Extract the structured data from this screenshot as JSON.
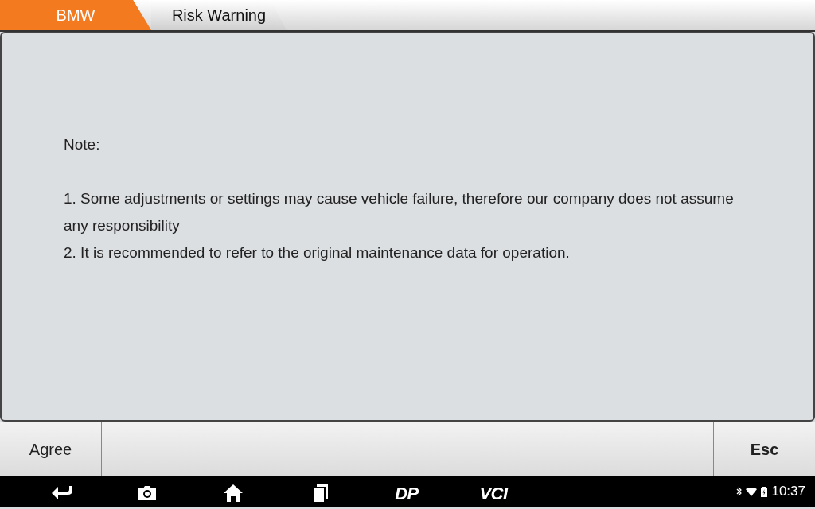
{
  "breadcrumbs": [
    {
      "label": "BMW",
      "selected": true
    },
    {
      "label": "Risk Warning",
      "selected": false
    }
  ],
  "content": {
    "heading": "Note:",
    "lines": [
      "1. Some adjustments or settings may cause vehicle failure,  therefore our company does not assume any responsibility",
      "2. It is recommended to refer to the original maintenance data for operation."
    ]
  },
  "buttons": [
    {
      "label": "Agree",
      "bold": false
    },
    {
      "label": "Esc",
      "bold": true
    }
  ],
  "nav_bar": {
    "items": [
      {
        "kind": "back"
      },
      {
        "kind": "camera"
      },
      {
        "kind": "home"
      },
      {
        "kind": "recent"
      },
      {
        "kind": "text",
        "label": "DP"
      },
      {
        "kind": "text",
        "label": "VCI"
      }
    ],
    "time": "10:37"
  }
}
